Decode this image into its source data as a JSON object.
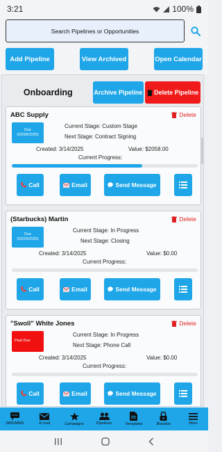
{
  "status": {
    "time": "3:21",
    "battery": "100%"
  },
  "search": {
    "label": "Search Pipelines or Opportunities"
  },
  "toolbar": {
    "add": "Add Pipeline",
    "archived": "View Archived",
    "calendar": "Open Calendar"
  },
  "pipeline": {
    "title": "Onboarding",
    "archive": "Archive Pipeline",
    "delete": "Delete Pipeline"
  },
  "labels": {
    "delete": "Delete",
    "call": "Call",
    "email": "Email",
    "send": "Send Message",
    "progress": "Current Progress:"
  },
  "cards": [
    {
      "name": "ABC Supply",
      "due_label": "Due",
      "due_date": "(03/28/2025)",
      "past_due": false,
      "current_stage": "Current Stage: Custom Stage",
      "next_stage": "Next Stage: Contract Signing",
      "created": "Created: 3/14/2025",
      "value": "Value: $2058.00",
      "progress": 0.7
    },
    {
      "name": "(Starbucks) Martin",
      "due_label": "Due",
      "due_date": "(03/29/2025)",
      "past_due": false,
      "current_stage": "Current Stage: In Progress",
      "next_stage": "Next Stage: Closing",
      "created": "Created: 3/14/2025",
      "value": "Value: $0.00",
      "progress": 0
    },
    {
      "name": "\"Swoll\" White Jones",
      "due_label": "Past Due",
      "due_date": "",
      "past_due": true,
      "current_stage": "Current Stage: In Progress",
      "next_stage": "Next Stage: Phone Call",
      "created": "Created: 3/14/2025",
      "value": "Value: $0.00",
      "progress": 0
    }
  ],
  "nav": [
    {
      "label": "SMS/MMS",
      "icon": "chat-icon"
    },
    {
      "label": "E-mail",
      "icon": "mail-icon"
    },
    {
      "label": "Campaigns",
      "icon": "star-icon"
    },
    {
      "label": "Pipelines",
      "icon": "people-icon"
    },
    {
      "label": "Templates",
      "icon": "document-icon"
    },
    {
      "label": "Blacklist",
      "icon": "lock-icon"
    },
    {
      "label": "More",
      "icon": "menu-icon"
    }
  ],
  "colors": {
    "accent": "#1ea6e8",
    "danger": "#f01a1a"
  }
}
